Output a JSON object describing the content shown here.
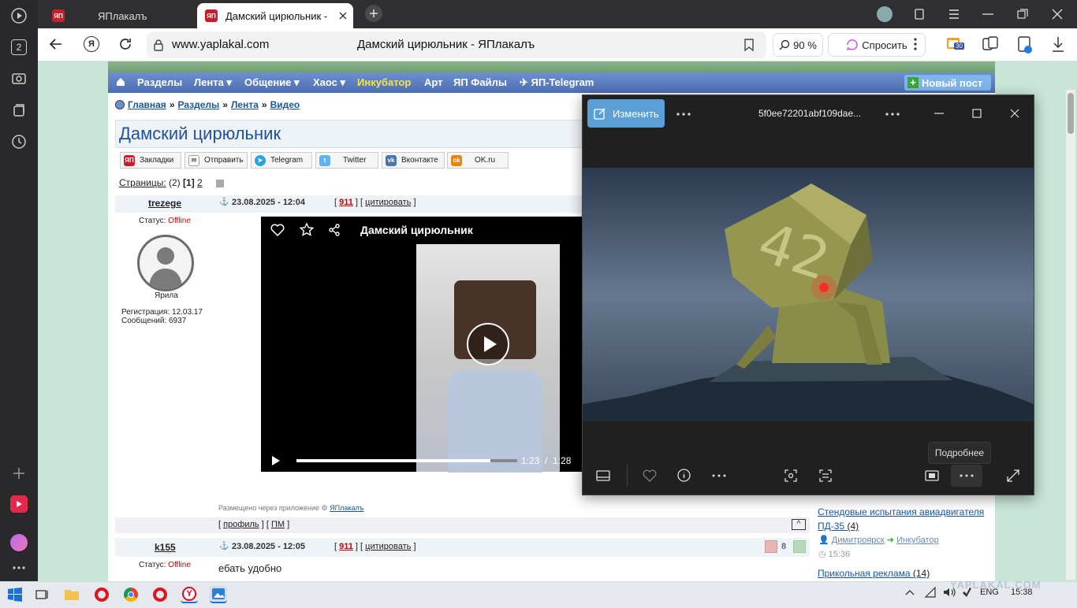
{
  "browser": {
    "tabs": [
      {
        "label": "ЯПлакалъ"
      },
      {
        "label": "Дамский цирюльник -"
      }
    ],
    "url": "www.yaplakal.com",
    "page_title": "Дамский цирюльник - ЯПлакалъ",
    "zoom": "90 %",
    "ask_label": "Спросить",
    "badge_count": "30",
    "rail_badge": "2"
  },
  "site": {
    "menu": [
      "Разделы",
      "Лента",
      "Общение",
      "Хаос",
      "Инкубатор",
      "Арт",
      "ЯП Файлы",
      "ЯП-Telegram"
    ],
    "new_post": "Новый пост",
    "breadcrumbs": [
      "Главная",
      "Разделы",
      "Лента",
      "Видео"
    ],
    "title": "Дамский цирюльник",
    "share": [
      "Закладки",
      "Отправить",
      "Telegram",
      "Twitter",
      "Вконтакте",
      "OK.ru"
    ],
    "pages_label": "Страницы:",
    "pages_count": "(2)",
    "page_current": "[1]",
    "page_next": "2",
    "post1": {
      "nick": "trezege",
      "date": "23.08.2025 - 12:04",
      "rating": "911",
      "quote": "цитировать",
      "status_label": "Статус:",
      "status_value": "Offline",
      "rank": "Ярила",
      "reg": "Регистрация: 12.03.17",
      "msgs": "Сообщений: 6937",
      "via": "Размещено через приложение",
      "via_app": "ЯПлакалъ",
      "profile": "профиль",
      "pm": "ПМ"
    },
    "video": {
      "title": "Дамский цирюльник",
      "time_current": "1:23",
      "time_sep": "/",
      "time_total": "1:28",
      "progress": 0.88
    },
    "post2": {
      "nick": "k155",
      "date": "23.08.2025 - 12:05",
      "rating": "911",
      "quote": "цитировать",
      "status_label": "Статус:",
      "status_value": "Offline",
      "text": "ебать удобно",
      "likes": "8"
    },
    "sidebar": {
      "link1": "Стендовые испытания авиадвигателя ПД-35",
      "link1_count": "(4)",
      "user": "Димитроярск",
      "section": "Инкубатор",
      "time": "15:36",
      "link2": "Прикольная реклама",
      "link2_count": "(14)"
    }
  },
  "photos": {
    "edit_label": "Изменить",
    "filename": "5f0ee72201abf109dae...",
    "tooltip": "Подробнее",
    "image_text": "42"
  },
  "taskbar": {
    "lang": "ENG",
    "time": "15:38",
    "watermark": "YAPLAKAL.COM"
  }
}
